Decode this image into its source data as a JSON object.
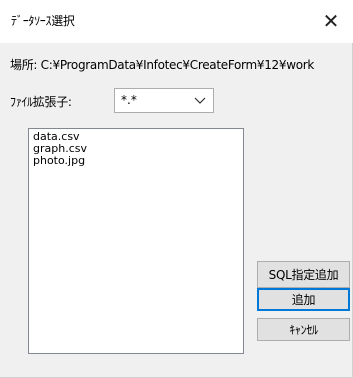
{
  "window": {
    "title": "ﾃﾞｰﾀｿｰｽ選択",
    "close_glyph": "✕"
  },
  "location": {
    "label_and_path": "場所: C:¥ProgramData¥Infotec¥CreateForm¥12¥work"
  },
  "extension": {
    "label": "ﾌｧｲﾙ拡張子:",
    "selected": "*.*"
  },
  "files": [
    "data.csv",
    "graph.csv",
    "photo.jpg"
  ],
  "buttons": {
    "sql_add": "SQL指定追加",
    "add": "追加",
    "cancel": "ｷｬﾝｾﾙ"
  }
}
